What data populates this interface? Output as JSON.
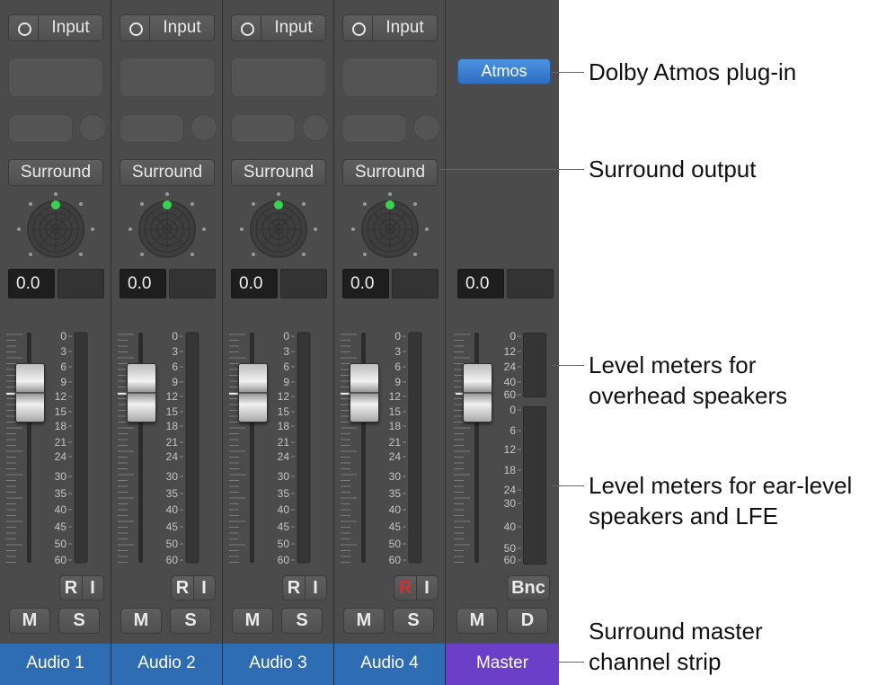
{
  "channels": [
    {
      "input": "Input",
      "output": "Surround",
      "volume": "0.0",
      "name": "Audio 1",
      "read_red": false
    },
    {
      "input": "Input",
      "output": "Surround",
      "volume": "0.0",
      "name": "Audio 2",
      "read_red": false
    },
    {
      "input": "Input",
      "output": "Surround",
      "volume": "0.0",
      "name": "Audio 3",
      "read_red": false
    },
    {
      "input": "Input",
      "output": "Surround",
      "volume": "0.0",
      "name": "Audio 4",
      "read_red": true
    }
  ],
  "buttons": {
    "read": "R",
    "input_monitor": "I",
    "mute": "M",
    "solo": "S"
  },
  "scale_labels": [
    "0",
    "3",
    "6",
    "9",
    "12",
    "15",
    "18",
    "21",
    "24",
    "30",
    "35",
    "40",
    "45",
    "50",
    "60"
  ],
  "master": {
    "plugin": "Atmos",
    "volume": "0.0",
    "bounce": "Bnc",
    "mute": "M",
    "dim": "D",
    "name": "Master",
    "overhead_scale": [
      "0",
      "12",
      "24",
      "40",
      "60"
    ],
    "ear_scale": [
      "0",
      "6",
      "12",
      "18",
      "24",
      "30",
      "40",
      "50",
      "60"
    ]
  },
  "callouts": [
    {
      "line1": "Dolby Atmos plug-in",
      "line2": ""
    },
    {
      "line1": "Surround output",
      "line2": ""
    },
    {
      "line1": "Level meters for",
      "line2": "overhead speakers"
    },
    {
      "line1": "Level meters for ear-level",
      "line2": "speakers and LFE"
    },
    {
      "line1": "Surround master",
      "line2": "channel strip"
    }
  ],
  "colors": {
    "mixer_bg": "#4b4b4b",
    "channel_name": "#2e6db4",
    "master_name": "#6b3fc8",
    "plugin_blue": "#3a80d2",
    "pan_dot": "#35d14f",
    "read_active": "#d32f2f"
  },
  "icons": {
    "input_ring": "ring-icon",
    "panner": "surround-panner-icon"
  }
}
